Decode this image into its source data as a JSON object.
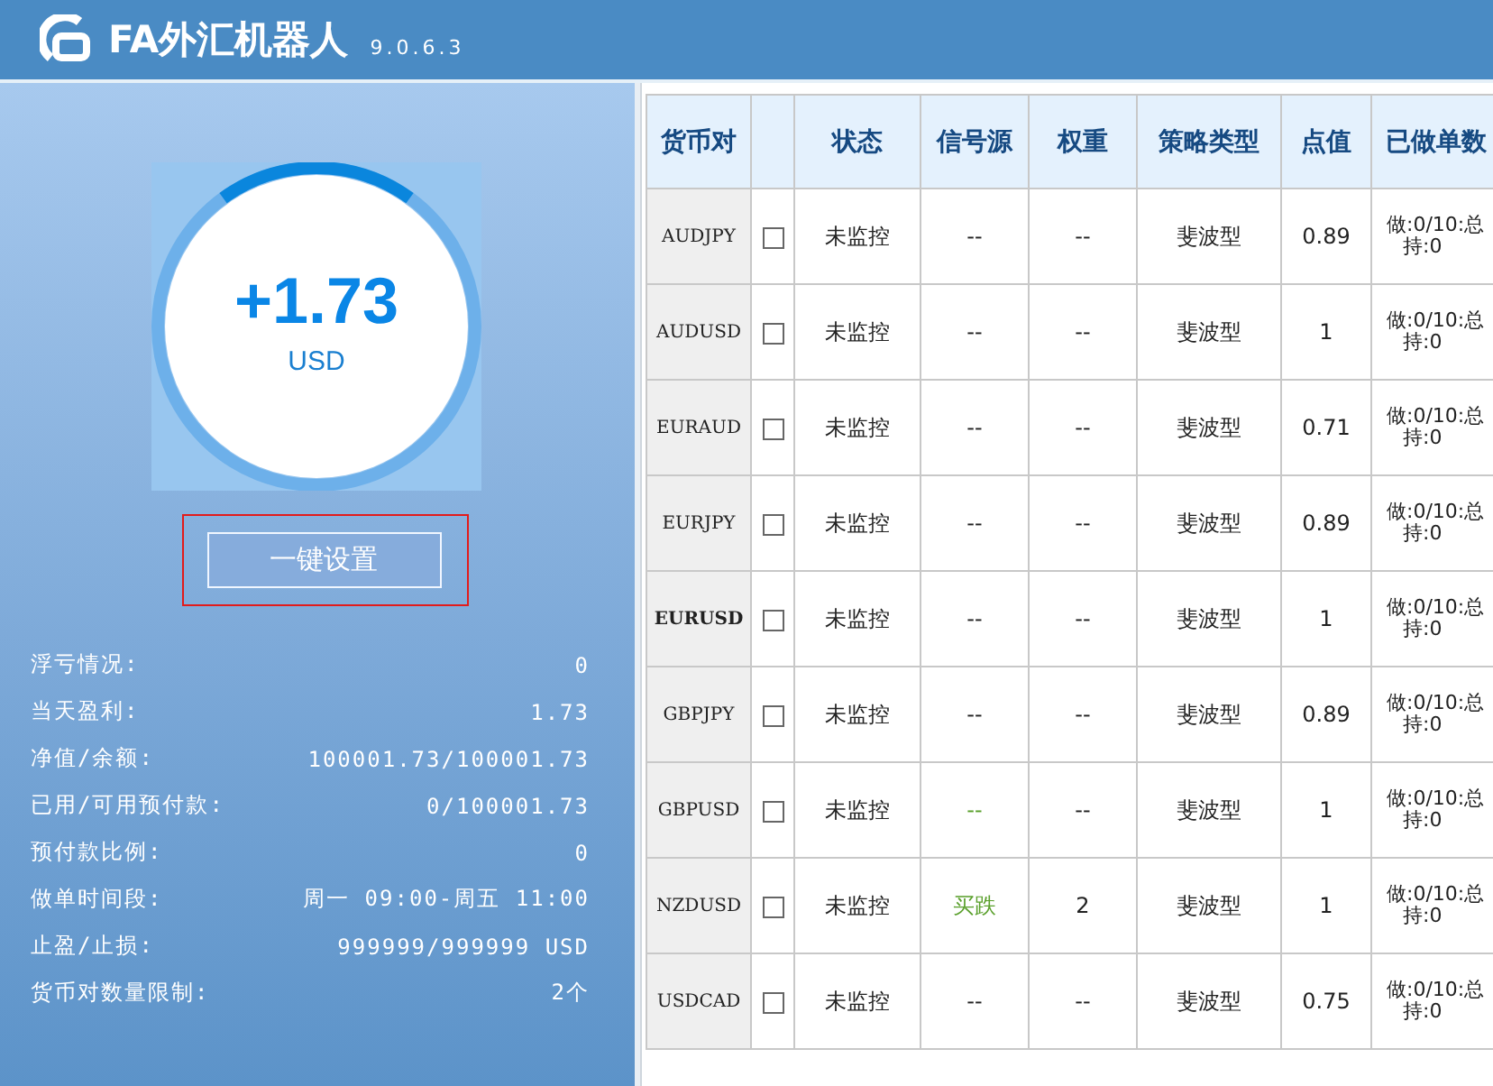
{
  "header": {
    "title": "FA外汇机器人",
    "version": "9.0.6.3"
  },
  "gauge": {
    "value": "+1.73",
    "unit": "USD",
    "level": 0.2
  },
  "setup_button": {
    "label": "一键设置",
    "focused": true
  },
  "stats": [
    {
      "label": "浮亏情况:",
      "value": "0"
    },
    {
      "label": "当天盈利:",
      "value": "1.73"
    },
    {
      "label": "净值/余额:",
      "value": "100001.73/100001.73"
    },
    {
      "label": "已用/可用预付款:",
      "value": "0/100001.73"
    },
    {
      "label": "预付款比例:",
      "value": "0"
    },
    {
      "label": "做单时间段:",
      "value": "周一 09:00-周五 11:00"
    },
    {
      "label": "止盈/止损:",
      "value": "999999/999999 USD"
    },
    {
      "label": "货币对数量限制:",
      "value": "2个"
    }
  ],
  "table": {
    "columns": [
      "货币对",
      "状态",
      "信号源",
      "权重",
      "策略类型",
      "点值",
      "已做单数"
    ],
    "rows": [
      {
        "pair": "AUDJPY",
        "bold": false,
        "checked": false,
        "status": "未监控",
        "signal": "--",
        "signal_highlighted": false,
        "weight": "--",
        "strategy": "斐波型",
        "point_value": "0.89",
        "orders": "做:0/10:总",
        "holding": "持:0"
      },
      {
        "pair": "AUDUSD",
        "bold": false,
        "checked": false,
        "status": "未监控",
        "signal": "--",
        "signal_highlighted": false,
        "weight": "--",
        "strategy": "斐波型",
        "point_value": "1",
        "orders": "做:0/10:总",
        "holding": "持:0"
      },
      {
        "pair": "EURAUD",
        "bold": false,
        "checked": false,
        "status": "未监控",
        "signal": "--",
        "signal_highlighted": false,
        "weight": "--",
        "strategy": "斐波型",
        "point_value": "0.71",
        "orders": "做:0/10:总",
        "holding": "持:0"
      },
      {
        "pair": "EURJPY",
        "bold": false,
        "checked": false,
        "status": "未监控",
        "signal": "--",
        "signal_highlighted": false,
        "weight": "--",
        "strategy": "斐波型",
        "point_value": "0.89",
        "orders": "做:0/10:总",
        "holding": "持:0"
      },
      {
        "pair": "EURUSD",
        "bold": true,
        "checked": false,
        "status": "未监控",
        "signal": "--",
        "signal_highlighted": false,
        "weight": "--",
        "strategy": "斐波型",
        "point_value": "1",
        "orders": "做:0/10:总",
        "holding": "持:0"
      },
      {
        "pair": "GBPJPY",
        "bold": false,
        "checked": false,
        "status": "未监控",
        "signal": "--",
        "signal_highlighted": false,
        "weight": "--",
        "strategy": "斐波型",
        "point_value": "0.89",
        "orders": "做:0/10:总",
        "holding": "持:0"
      },
      {
        "pair": "GBPUSD",
        "bold": false,
        "checked": false,
        "status": "未监控",
        "signal": "--",
        "signal_highlighted": true,
        "weight": "--",
        "strategy": "斐波型",
        "point_value": "1",
        "orders": "做:0/10:总",
        "holding": "持:0"
      },
      {
        "pair": "NZDUSD",
        "bold": false,
        "checked": false,
        "status": "未监控",
        "signal": "买跌",
        "signal_highlighted": true,
        "weight": "2",
        "strategy": "斐波型",
        "point_value": "1",
        "orders": "做:0/10:总",
        "holding": "持:0"
      },
      {
        "pair": "USDCAD",
        "bold": false,
        "checked": false,
        "status": "未监控",
        "signal": "--",
        "signal_highlighted": false,
        "weight": "--",
        "strategy": "斐波型",
        "point_value": "0.75",
        "orders": "做:0/10:总",
        "holding": "持:0"
      }
    ]
  }
}
